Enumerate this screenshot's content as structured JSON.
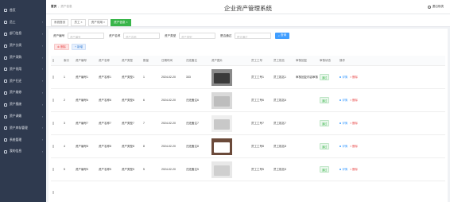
{
  "sidebar": {
    "items": [
      {
        "label": "首页",
        "icon": "home-icon",
        "arrow": ""
      },
      {
        "label": "员工",
        "icon": "user-icon",
        "arrow": "›"
      },
      {
        "label": "部门信息",
        "icon": "department-icon",
        "arrow": "›"
      },
      {
        "label": "资产分类",
        "icon": "category-icon",
        "arrow": "›"
      },
      {
        "label": "资产采购",
        "icon": "purchase-icon",
        "arrow": "›"
      },
      {
        "label": "资产领用",
        "icon": "receive-icon",
        "arrow": "›"
      },
      {
        "label": "资产归还",
        "icon": "return-icon",
        "arrow": "›"
      },
      {
        "label": "资产维修",
        "icon": "repair-icon",
        "arrow": "›"
      },
      {
        "label": "资产报废",
        "icon": "scrap-icon",
        "arrow": "›"
      },
      {
        "label": "资产调拨",
        "icon": "transfer-icon",
        "arrow": "›"
      },
      {
        "label": "资产库存管理",
        "icon": "inventory-icon",
        "arrow": "›"
      },
      {
        "label": "系统管理",
        "icon": "settings-icon",
        "arrow": "›"
      },
      {
        "label": "我的信息",
        "icon": "profile-icon",
        "arrow": "›"
      }
    ]
  },
  "header": {
    "breadcrumb": [
      "首页",
      "资产信息"
    ],
    "title": "企业资产管理系统",
    "logout": "退出系统"
  },
  "tabs": [
    "系统首页",
    "员工 ×",
    "资产领用 ×",
    "资产信息 ×"
  ],
  "filters": {
    "fields": [
      {
        "label": "资产编号",
        "placeholder": "资产编号"
      },
      {
        "label": "资产名称",
        "placeholder": "资产名称"
      },
      {
        "label": "资产类型",
        "placeholder": "资产类型"
      },
      {
        "label": "是否通过",
        "placeholder": "是否通过"
      }
    ],
    "search_label": "查询"
  },
  "actions": {
    "delete_label": "删除",
    "add_label": "新增"
  },
  "table": {
    "headers": [
      "",
      "索引",
      "资产编号",
      "资产名称",
      "资产类型",
      "数量",
      "日期时间",
      "归还备注",
      "资产图片",
      "员工工号",
      "员工姓名",
      "审核回复",
      "审核状态",
      "操作"
    ],
    "rows": [
      {
        "index": "1",
        "code": "资产编号1",
        "name": "资产名称1",
        "type": "资产类型1",
        "qty": "1",
        "date": "2024-02-20",
        "note": "333",
        "emp_no": "员工工号1",
        "emp_name": "员工姓名1",
        "reply": "审核回复内容审核回复",
        "status": "通过"
      },
      {
        "index": "2",
        "code": "资产编号6",
        "name": "资产名称6",
        "type": "资产类型6",
        "qty": "6",
        "date": "2024-02-20",
        "note": "归还备注6",
        "emp_no": "员工工号6",
        "emp_name": "员工姓名6",
        "reply": "",
        "status": "通过"
      },
      {
        "index": "3",
        "code": "资产编号7",
        "name": "资产名称7",
        "type": "资产类型7",
        "qty": "7",
        "date": "2024-02-20",
        "note": "归还备注7",
        "emp_no": "员工工号7",
        "emp_name": "员工姓名7",
        "reply": "",
        "status": "通过"
      },
      {
        "index": "4",
        "code": "资产编号8",
        "name": "资产名称8",
        "type": "资产类型8",
        "qty": "8",
        "date": "2024-02-20",
        "note": "归还备注8",
        "emp_no": "员工工号8",
        "emp_name": "员工姓名8",
        "reply": "",
        "status": "通过"
      },
      {
        "index": "5",
        "code": "资产编号5",
        "name": "资产名称5",
        "type": "资产类型5",
        "qty": "5",
        "date": "2024-02-20",
        "note": "归还备注5",
        "emp_no": "员工工号5",
        "emp_name": "员工姓名5",
        "reply": "",
        "status": "通过"
      },
      {
        "index": "",
        "code": "",
        "name": "",
        "type": "",
        "qty": "",
        "date": "",
        "note": "",
        "emp_no": "",
        "emp_name": "",
        "reply": "",
        "status": ""
      }
    ],
    "op_view": "详情",
    "op_delete": "删除"
  },
  "colors": {
    "sidebar": "#2f3a4f",
    "accent": "#39b54a",
    "primary": "#409eff",
    "danger": "#e84c4c"
  }
}
